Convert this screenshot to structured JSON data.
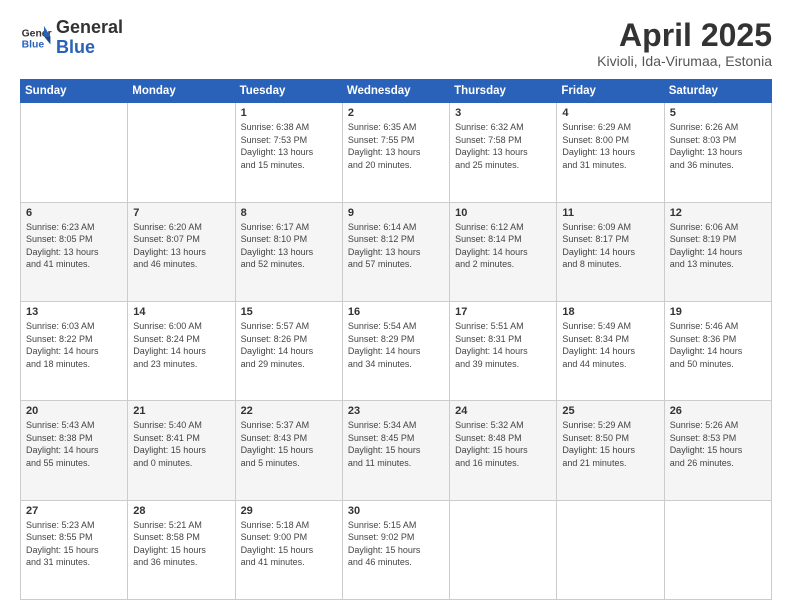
{
  "header": {
    "logo_line1": "General",
    "logo_line2": "Blue",
    "title": "April 2025",
    "subtitle": "Kivioli, Ida-Virumaa, Estonia"
  },
  "weekdays": [
    "Sunday",
    "Monday",
    "Tuesday",
    "Wednesday",
    "Thursday",
    "Friday",
    "Saturday"
  ],
  "weeks": [
    [
      {
        "day": "",
        "info": ""
      },
      {
        "day": "",
        "info": ""
      },
      {
        "day": "1",
        "info": "Sunrise: 6:38 AM\nSunset: 7:53 PM\nDaylight: 13 hours\nand 15 minutes."
      },
      {
        "day": "2",
        "info": "Sunrise: 6:35 AM\nSunset: 7:55 PM\nDaylight: 13 hours\nand 20 minutes."
      },
      {
        "day": "3",
        "info": "Sunrise: 6:32 AM\nSunset: 7:58 PM\nDaylight: 13 hours\nand 25 minutes."
      },
      {
        "day": "4",
        "info": "Sunrise: 6:29 AM\nSunset: 8:00 PM\nDaylight: 13 hours\nand 31 minutes."
      },
      {
        "day": "5",
        "info": "Sunrise: 6:26 AM\nSunset: 8:03 PM\nDaylight: 13 hours\nand 36 minutes."
      }
    ],
    [
      {
        "day": "6",
        "info": "Sunrise: 6:23 AM\nSunset: 8:05 PM\nDaylight: 13 hours\nand 41 minutes."
      },
      {
        "day": "7",
        "info": "Sunrise: 6:20 AM\nSunset: 8:07 PM\nDaylight: 13 hours\nand 46 minutes."
      },
      {
        "day": "8",
        "info": "Sunrise: 6:17 AM\nSunset: 8:10 PM\nDaylight: 13 hours\nand 52 minutes."
      },
      {
        "day": "9",
        "info": "Sunrise: 6:14 AM\nSunset: 8:12 PM\nDaylight: 13 hours\nand 57 minutes."
      },
      {
        "day": "10",
        "info": "Sunrise: 6:12 AM\nSunset: 8:14 PM\nDaylight: 14 hours\nand 2 minutes."
      },
      {
        "day": "11",
        "info": "Sunrise: 6:09 AM\nSunset: 8:17 PM\nDaylight: 14 hours\nand 8 minutes."
      },
      {
        "day": "12",
        "info": "Sunrise: 6:06 AM\nSunset: 8:19 PM\nDaylight: 14 hours\nand 13 minutes."
      }
    ],
    [
      {
        "day": "13",
        "info": "Sunrise: 6:03 AM\nSunset: 8:22 PM\nDaylight: 14 hours\nand 18 minutes."
      },
      {
        "day": "14",
        "info": "Sunrise: 6:00 AM\nSunset: 8:24 PM\nDaylight: 14 hours\nand 23 minutes."
      },
      {
        "day": "15",
        "info": "Sunrise: 5:57 AM\nSunset: 8:26 PM\nDaylight: 14 hours\nand 29 minutes."
      },
      {
        "day": "16",
        "info": "Sunrise: 5:54 AM\nSunset: 8:29 PM\nDaylight: 14 hours\nand 34 minutes."
      },
      {
        "day": "17",
        "info": "Sunrise: 5:51 AM\nSunset: 8:31 PM\nDaylight: 14 hours\nand 39 minutes."
      },
      {
        "day": "18",
        "info": "Sunrise: 5:49 AM\nSunset: 8:34 PM\nDaylight: 14 hours\nand 44 minutes."
      },
      {
        "day": "19",
        "info": "Sunrise: 5:46 AM\nSunset: 8:36 PM\nDaylight: 14 hours\nand 50 minutes."
      }
    ],
    [
      {
        "day": "20",
        "info": "Sunrise: 5:43 AM\nSunset: 8:38 PM\nDaylight: 14 hours\nand 55 minutes."
      },
      {
        "day": "21",
        "info": "Sunrise: 5:40 AM\nSunset: 8:41 PM\nDaylight: 15 hours\nand 0 minutes."
      },
      {
        "day": "22",
        "info": "Sunrise: 5:37 AM\nSunset: 8:43 PM\nDaylight: 15 hours\nand 5 minutes."
      },
      {
        "day": "23",
        "info": "Sunrise: 5:34 AM\nSunset: 8:45 PM\nDaylight: 15 hours\nand 11 minutes."
      },
      {
        "day": "24",
        "info": "Sunrise: 5:32 AM\nSunset: 8:48 PM\nDaylight: 15 hours\nand 16 minutes."
      },
      {
        "day": "25",
        "info": "Sunrise: 5:29 AM\nSunset: 8:50 PM\nDaylight: 15 hours\nand 21 minutes."
      },
      {
        "day": "26",
        "info": "Sunrise: 5:26 AM\nSunset: 8:53 PM\nDaylight: 15 hours\nand 26 minutes."
      }
    ],
    [
      {
        "day": "27",
        "info": "Sunrise: 5:23 AM\nSunset: 8:55 PM\nDaylight: 15 hours\nand 31 minutes."
      },
      {
        "day": "28",
        "info": "Sunrise: 5:21 AM\nSunset: 8:58 PM\nDaylight: 15 hours\nand 36 minutes."
      },
      {
        "day": "29",
        "info": "Sunrise: 5:18 AM\nSunset: 9:00 PM\nDaylight: 15 hours\nand 41 minutes."
      },
      {
        "day": "30",
        "info": "Sunrise: 5:15 AM\nSunset: 9:02 PM\nDaylight: 15 hours\nand 46 minutes."
      },
      {
        "day": "",
        "info": ""
      },
      {
        "day": "",
        "info": ""
      },
      {
        "day": "",
        "info": ""
      }
    ]
  ]
}
